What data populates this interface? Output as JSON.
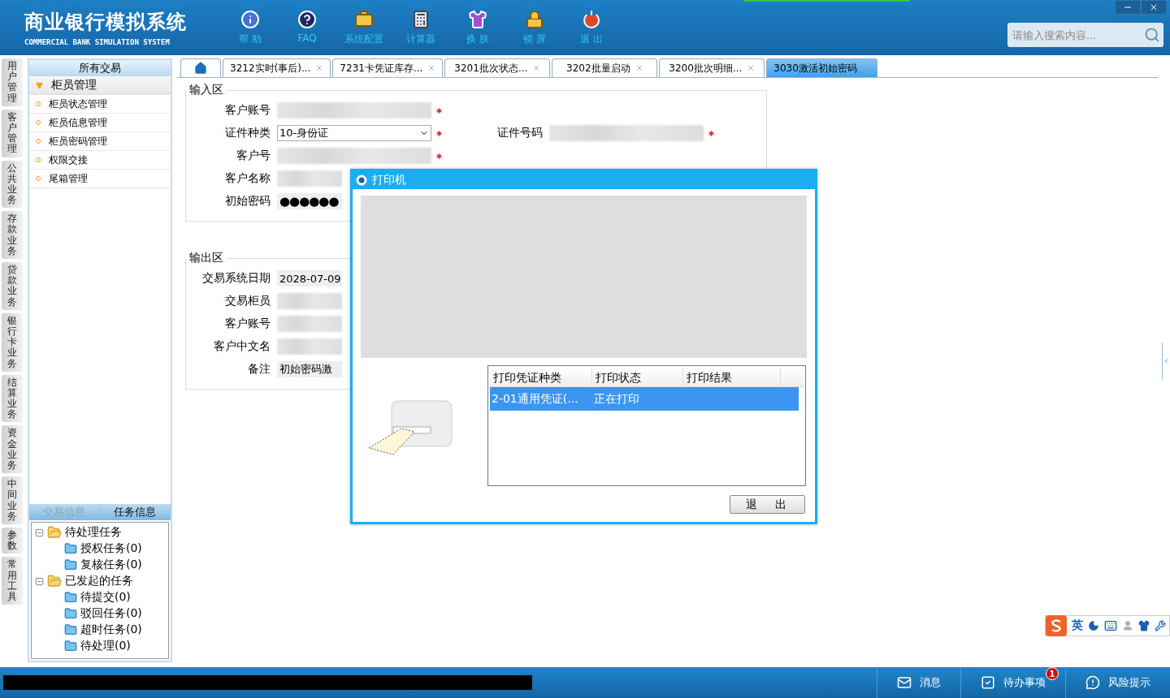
{
  "header": {
    "title": "商业银行模拟系统",
    "subtitle": "COMMERCIAL BANK SIMULATION SYSTEM",
    "toolbar": [
      {
        "label": "帮 助",
        "kind": "help"
      },
      {
        "label": "FAQ",
        "kind": "faq"
      },
      {
        "label": "系统配置",
        "kind": "config"
      },
      {
        "label": "计算器",
        "kind": "calculator"
      },
      {
        "label": "换 肤",
        "kind": "skin"
      },
      {
        "label": "锁 屏",
        "kind": "lock"
      },
      {
        "label": "退 出",
        "kind": "exit"
      }
    ],
    "search": {
      "placeholder": "请输入搜索内容..."
    }
  },
  "side_tabs": [
    "用户管理",
    "客户管理",
    "公共业务",
    "存款业务",
    "贷款业务",
    "银行卡业务",
    "结算业务",
    "资金业务",
    "中间业务",
    "参数",
    "常用工具"
  ],
  "sidebar": {
    "title": "所有交易",
    "groups": [
      {
        "label": "柜员管理",
        "expanded": true,
        "items": [
          "柜员状态管理",
          "柜员信息管理",
          "柜员密码管理",
          "权限交接",
          "尾箱管理"
        ]
      }
    ],
    "panel_tabs": [
      {
        "label": "交易信息",
        "selected": false
      },
      {
        "label": "任务信息",
        "selected": true
      }
    ],
    "tree": [
      {
        "label": "待处理任务",
        "expanded": true,
        "children": [
          {
            "label": "授权任务(0)"
          },
          {
            "label": "复核任务(0)"
          }
        ]
      },
      {
        "label": "已发起的任务",
        "expanded": true,
        "children": [
          {
            "label": "待提交(0)"
          },
          {
            "label": "驳回任务(0)"
          },
          {
            "label": "超时任务(0)"
          },
          {
            "label": "待处理(0)"
          }
        ]
      }
    ]
  },
  "tabs": [
    {
      "kind": "home",
      "selected": false
    },
    {
      "kind": "page",
      "label": "3212实时(事后)...",
      "selected": false
    },
    {
      "kind": "page",
      "label": "7231卡凭证库存...",
      "selected": false
    },
    {
      "kind": "page",
      "label": "3201批次状态...",
      "selected": false
    },
    {
      "kind": "page",
      "label": "3202批量启动",
      "selected": false
    },
    {
      "kind": "page",
      "label": "3200批次明细...",
      "selected": false
    },
    {
      "kind": "page",
      "label": "3030激活初始密码",
      "selected": true
    }
  ],
  "input_area": {
    "title": "输入区",
    "rows": [
      [
        {
          "label": "客户账号",
          "kind": "blurred",
          "required": true
        }
      ],
      [
        {
          "label": "证件种类",
          "kind": "select",
          "value": "10-身份证",
          "required": true
        },
        {
          "label": "证件号码",
          "kind": "blurred",
          "required": true
        }
      ],
      [
        {
          "label": "客户号",
          "kind": "blurred",
          "required": true
        }
      ],
      [
        {
          "label": "客户名称",
          "kind": "blurred",
          "required": false
        }
      ],
      [
        {
          "label": "初始密码",
          "kind": "password",
          "value": "●●●●●●",
          "required": false
        }
      ]
    ]
  },
  "output_area": {
    "title": "输出区",
    "fields": [
      {
        "label": "交易系统日期",
        "kind": "text",
        "value": "2028-07-09"
      },
      {
        "label": "交易柜员",
        "kind": "blurred"
      },
      {
        "label": "客户账号",
        "kind": "blurred"
      },
      {
        "label": "客户中文名",
        "kind": "blurred"
      },
      {
        "label": "备注",
        "kind": "text",
        "value": "初始密码激"
      }
    ]
  },
  "dialog": {
    "title": "打印机",
    "columns": [
      "打印凭证种类",
      "打印状态",
      "打印结果"
    ],
    "rows": [
      {
        "cells": [
          "2-01通用凭证(...",
          "正在打印",
          ""
        ],
        "selected": true
      }
    ],
    "button": "退　出"
  },
  "ime": {
    "label": "英"
  },
  "status_bar": [
    {
      "kind": "message",
      "label": "消息"
    },
    {
      "kind": "todo",
      "label": "待办事项",
      "badge": "1"
    },
    {
      "kind": "risk",
      "label": "风险提示"
    }
  ]
}
